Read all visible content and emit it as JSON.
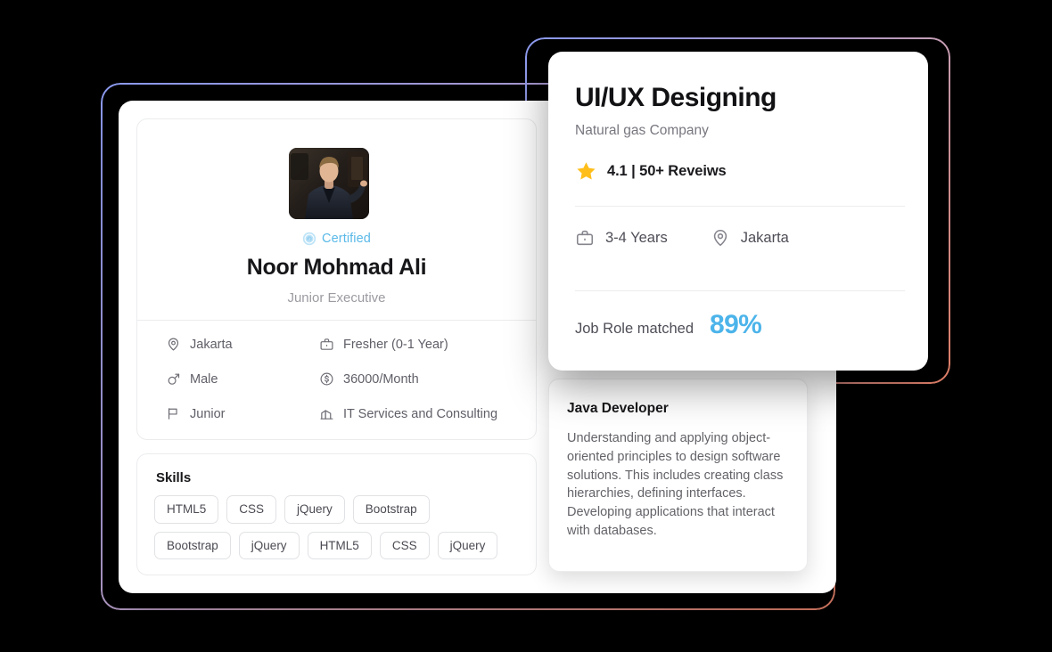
{
  "theme": {
    "background": "#000000",
    "card_bg": "#ffffff",
    "accent_blue": "#4cb4ea",
    "certified_blue": "#5ab9e8",
    "star_yellow": "#ffbe1a",
    "border_gradient_start": "#8c9bf0",
    "border_gradient_end": "#e8836a",
    "text_dark": "#17171a",
    "text_muted": "#9b9ba1",
    "divider": "#ebecee"
  },
  "profile_card": {
    "avatar_alt": "profile-photo",
    "certified": {
      "icon": "certified-badge-icon",
      "label": "Certified"
    },
    "name": "Noor Mohmad Ali",
    "role": "Junior Executive",
    "details": [
      {
        "icon": "location-pin-icon",
        "value": "Jakarta"
      },
      {
        "icon": "briefcase-icon",
        "value": "Fresher (0-1 Year)"
      },
      {
        "icon": "male-gender-icon",
        "value": "Male"
      },
      {
        "icon": "dollar-circle-icon",
        "value": "36000/Month"
      },
      {
        "icon": "flag-icon",
        "value": "Junior"
      },
      {
        "icon": "building-icon",
        "value": "IT Services and Consulting"
      }
    ],
    "skills": {
      "title": "Skills",
      "row1": [
        "HTML5",
        "CSS",
        "jQuery",
        "Bootstrap"
      ],
      "row2": [
        "Bootstrap",
        "jQuery",
        "HTML5",
        "CSS",
        "jQuery"
      ]
    }
  },
  "job_card": {
    "title": "UI/UX Designing",
    "company": "Natural gas Company",
    "rating": {
      "icon": "star-icon",
      "text": "4.1 | 50+ Reveiws",
      "score": "4.1",
      "review_count": "50+"
    },
    "facts": [
      {
        "icon": "briefcase-icon",
        "value": "3-4 Years"
      },
      {
        "icon": "location-pin-icon",
        "value": "Jakarta"
      }
    ],
    "match": {
      "label": "Job Role matched",
      "value": "89%"
    }
  },
  "java_card": {
    "title": "Java Developer",
    "description": "Understanding and applying object-oriented principles to design software solutions. This includes creating class hierarchies, defining interfaces. Developing applications that interact with databases."
  }
}
